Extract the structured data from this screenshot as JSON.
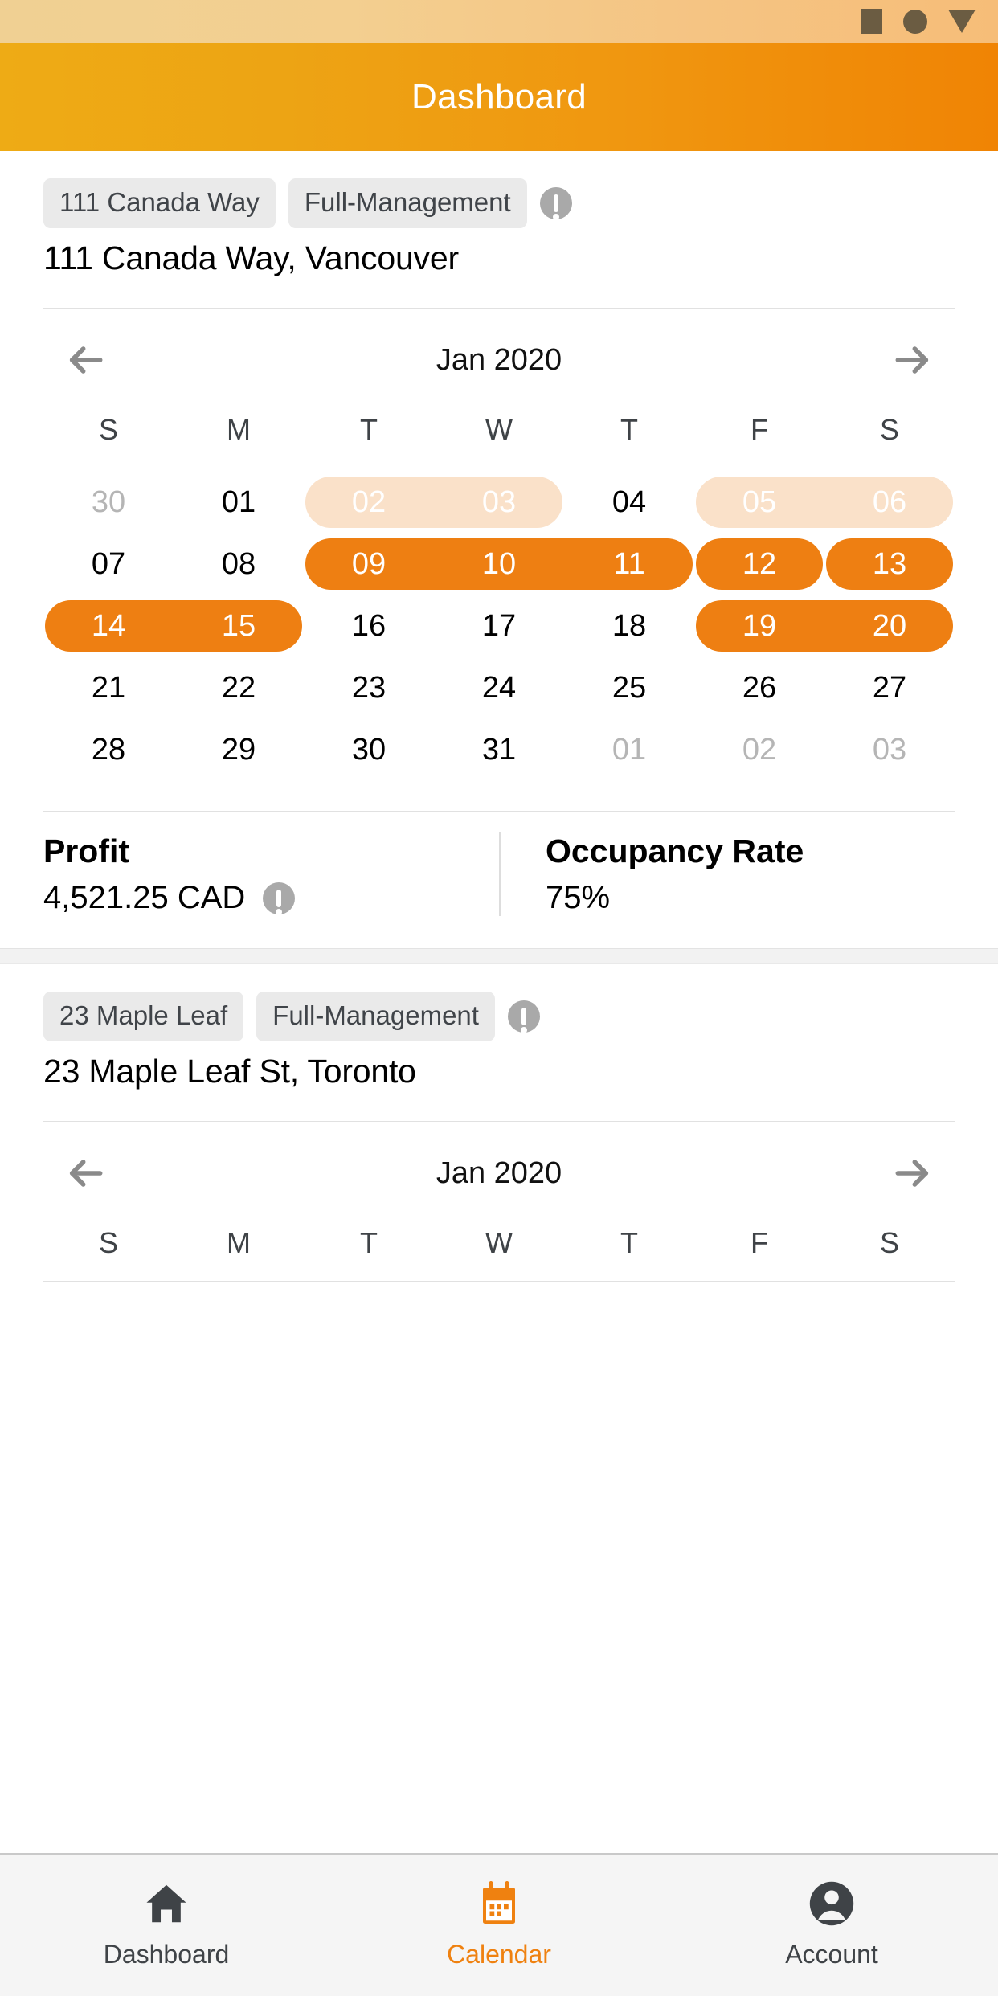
{
  "status_bar": {
    "icons": [
      "stop-square-icon",
      "record-circle-icon",
      "dropdown-triangle-icon"
    ]
  },
  "app_bar": {
    "title": "Dashboard",
    "gradient_from": "#eeab15",
    "gradient_to": "#f08404"
  },
  "colors": {
    "accent": "#ee7f12",
    "accent_faded": "#fae1c9",
    "badge_bg": "#eaeaea",
    "info_icon": "#a9a9a9",
    "muted_day": "#b5b5b5"
  },
  "properties": [
    {
      "badge_name": "111 Canada Way",
      "badge_type": "Full-Management",
      "address": "111 Canada Way, Vancouver",
      "calendar": {
        "month_label": "Jan 2020",
        "prev_label": "previous month",
        "next_label": "next month",
        "weekdays": [
          "S",
          "M",
          "T",
          "W",
          "T",
          "F",
          "S"
        ],
        "rows": [
          {
            "days": [
              {
                "label": "30",
                "state": "muted"
              },
              {
                "label": "01",
                "state": "normal"
              },
              {
                "label": "02",
                "state": "faded"
              },
              {
                "label": "03",
                "state": "faded"
              },
              {
                "label": "04",
                "state": "normal"
              },
              {
                "label": "05",
                "state": "faded"
              },
              {
                "label": "06",
                "state": "faded"
              }
            ],
            "pills": [
              {
                "start": 2,
                "end": 3,
                "style": "faded"
              },
              {
                "start": 5,
                "end": 6,
                "style": "faded"
              }
            ]
          },
          {
            "days": [
              {
                "label": "07",
                "state": "normal"
              },
              {
                "label": "08",
                "state": "normal"
              },
              {
                "label": "09",
                "state": "booked"
              },
              {
                "label": "10",
                "state": "booked"
              },
              {
                "label": "11",
                "state": "booked"
              },
              {
                "label": "12",
                "state": "booked"
              },
              {
                "label": "13",
                "state": "booked"
              }
            ],
            "pills": [
              {
                "start": 2,
                "end": 4,
                "style": "solid"
              },
              {
                "start": 5,
                "end": 5,
                "style": "solid"
              },
              {
                "start": 6,
                "end": 6,
                "style": "solid"
              }
            ]
          },
          {
            "days": [
              {
                "label": "14",
                "state": "booked"
              },
              {
                "label": "15",
                "state": "booked"
              },
              {
                "label": "16",
                "state": "normal"
              },
              {
                "label": "17",
                "state": "normal"
              },
              {
                "label": "18",
                "state": "normal"
              },
              {
                "label": "19",
                "state": "booked"
              },
              {
                "label": "20",
                "state": "booked"
              }
            ],
            "pills": [
              {
                "start": 0,
                "end": 1,
                "style": "solid"
              },
              {
                "start": 5,
                "end": 6,
                "style": "solid"
              }
            ]
          },
          {
            "days": [
              {
                "label": "21",
                "state": "normal"
              },
              {
                "label": "22",
                "state": "normal"
              },
              {
                "label": "23",
                "state": "normal"
              },
              {
                "label": "24",
                "state": "normal"
              },
              {
                "label": "25",
                "state": "normal"
              },
              {
                "label": "26",
                "state": "normal"
              },
              {
                "label": "27",
                "state": "normal"
              }
            ],
            "pills": []
          },
          {
            "days": [
              {
                "label": "28",
                "state": "normal"
              },
              {
                "label": "29",
                "state": "normal"
              },
              {
                "label": "30",
                "state": "normal"
              },
              {
                "label": "31",
                "state": "normal"
              },
              {
                "label": "01",
                "state": "muted"
              },
              {
                "label": "02",
                "state": "muted"
              },
              {
                "label": "03",
                "state": "muted"
              }
            ],
            "pills": []
          }
        ]
      },
      "stats": [
        {
          "label": "Profit",
          "value": "4,521.25 CAD",
          "has_info": true
        },
        {
          "label": "Occupancy Rate",
          "value": "75%",
          "has_info": false
        }
      ]
    },
    {
      "badge_name": "23 Maple Leaf",
      "badge_type": "Full-Management",
      "address": "23 Maple Leaf St, Toronto",
      "calendar": {
        "month_label": "Jan 2020",
        "prev_label": "previous month",
        "next_label": "next month",
        "weekdays": [
          "S",
          "M",
          "T",
          "W",
          "T",
          "F",
          "S"
        ],
        "rows": []
      },
      "stats": []
    }
  ],
  "bottom_nav": {
    "items": [
      {
        "label": "Dashboard",
        "icon": "home-icon",
        "active": false
      },
      {
        "label": "Calendar",
        "icon": "calendar-icon",
        "active": true
      },
      {
        "label": "Account",
        "icon": "account-icon",
        "active": false
      }
    ]
  }
}
